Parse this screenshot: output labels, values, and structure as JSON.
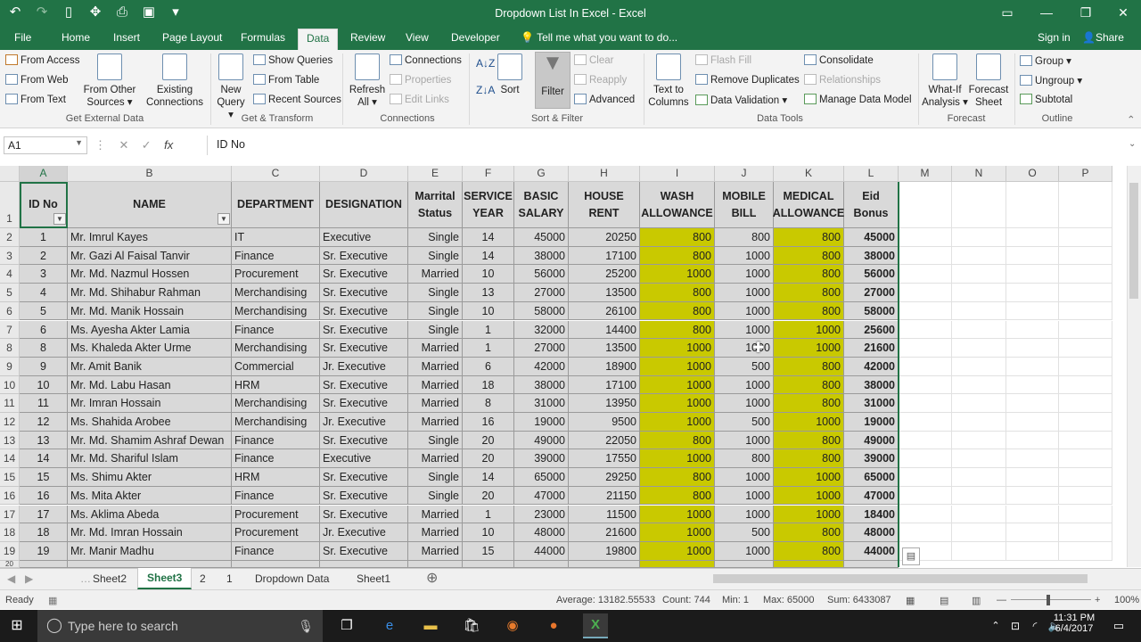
{
  "window": {
    "title": "Dropdown List In Excel - Excel"
  },
  "tabs": [
    "File",
    "Home",
    "Insert",
    "Page Layout",
    "Formulas",
    "Data",
    "Review",
    "View",
    "Developer"
  ],
  "tell_me": "Tell me what you want to do...",
  "sign_in": "Sign in",
  "share": "Share",
  "ribbon": {
    "get_external": {
      "from_access": "From Access",
      "from_web": "From Web",
      "from_text": "From Text",
      "from_other_1": "From Other",
      "from_other_2": "Sources",
      "existing_1": "Existing",
      "existing_2": "Connections",
      "label": "Get External Data"
    },
    "transform": {
      "new_query_1": "New",
      "new_query_2": "Query",
      "show_queries": "Show Queries",
      "from_table": "From Table",
      "recent_sources": "Recent Sources",
      "label": "Get & Transform"
    },
    "connections": {
      "refresh_1": "Refresh",
      "refresh_2": "All",
      "connections": "Connections",
      "properties": "Properties",
      "edit_links": "Edit Links",
      "label": "Connections"
    },
    "sortfilter": {
      "sort": "Sort",
      "filter": "Filter",
      "clear": "Clear",
      "reapply": "Reapply",
      "advanced": "Advanced",
      "label": "Sort & Filter"
    },
    "datatools": {
      "text_1": "Text to",
      "text_2": "Columns",
      "flash_fill": "Flash Fill",
      "remove_dup": "Remove Duplicates",
      "data_validation": "Data Validation",
      "consolidate": "Consolidate",
      "relationships": "Relationships",
      "manage_model": "Manage Data Model",
      "label": "Data Tools"
    },
    "forecast": {
      "whatif_1": "What-If",
      "whatif_2": "Analysis",
      "sheet_1": "Forecast",
      "sheet_2": "Sheet",
      "label": "Forecast"
    },
    "outline": {
      "group": "Group",
      "ungroup": "Ungroup",
      "subtotal": "Subtotal",
      "label": "Outline"
    }
  },
  "formula_bar": {
    "name_box": "A1",
    "content": "ID No"
  },
  "columns": [
    "A",
    "B",
    "C",
    "D",
    "E",
    "F",
    "G",
    "H",
    "I",
    "J",
    "K",
    "L",
    "M",
    "N",
    "O",
    "P"
  ],
  "headers": {
    "id": "ID No",
    "name": "NAME",
    "dept": "DEPARTMENT",
    "desig": "DESIGNATION",
    "status_1": "Marrital",
    "status_2": "Status",
    "service_1": "SERVICE",
    "service_2": "YEAR",
    "basic_1": "BASIC",
    "basic_2": "SALARY",
    "house": "HOUSE RENT",
    "wash_1": "WASH",
    "wash_2": "ALLOWANCE",
    "mobile_1": "MOBILE",
    "mobile_2": "BILL",
    "medical_1": "MEDICAL",
    "medical_2": "ALLOWANCE",
    "eid_1": "Eid",
    "eid_2": "Bonus"
  },
  "rows": [
    [
      "1",
      "Mr. Imrul Kayes",
      "IT",
      "Executive",
      "Single",
      "14",
      "45000",
      "20250",
      "800",
      "800",
      "800",
      "45000"
    ],
    [
      "2",
      "Mr. Gazi Al Faisal Tanvir",
      "Finance",
      "Sr. Executive",
      "Single",
      "14",
      "38000",
      "17100",
      "800",
      "1000",
      "800",
      "38000"
    ],
    [
      "3",
      "Mr. Md. Nazmul Hossen",
      "Procurement",
      "Sr. Executive",
      "Married",
      "10",
      "56000",
      "25200",
      "1000",
      "1000",
      "800",
      "56000"
    ],
    [
      "4",
      "Mr. Md. Shihabur Rahman",
      "Merchandising",
      "Sr. Executive",
      "Single",
      "13",
      "27000",
      "13500",
      "800",
      "1000",
      "800",
      "27000"
    ],
    [
      "5",
      "Mr. Md. Manik Hossain",
      "Merchandising",
      "Sr. Executive",
      "Single",
      "10",
      "58000",
      "26100",
      "800",
      "1000",
      "800",
      "58000"
    ],
    [
      "6",
      "Ms. Ayesha Akter Lamia",
      "Finance",
      "Sr. Executive",
      "Single",
      "1",
      "32000",
      "14400",
      "800",
      "1000",
      "1000",
      "25600"
    ],
    [
      "8",
      "Ms. Khaleda Akter Urme",
      "Merchandising",
      "Sr. Executive",
      "Married",
      "1",
      "27000",
      "13500",
      "1000",
      "1000",
      "1000",
      "21600"
    ],
    [
      "9",
      "Mr. Amit Banik",
      "Commercial",
      "Jr. Executive",
      "Married",
      "6",
      "42000",
      "18900",
      "1000",
      "500",
      "800",
      "42000"
    ],
    [
      "10",
      "Mr. Md. Labu Hasan",
      "HRM",
      "Sr. Executive",
      "Married",
      "18",
      "38000",
      "17100",
      "1000",
      "1000",
      "800",
      "38000"
    ],
    [
      "11",
      "Mr. Imran Hossain",
      "Merchandising",
      "Sr. Executive",
      "Married",
      "8",
      "31000",
      "13950",
      "1000",
      "1000",
      "800",
      "31000"
    ],
    [
      "12",
      "Ms. Shahida Arobee",
      "Merchandising",
      "Jr. Executive",
      "Married",
      "16",
      "19000",
      "9500",
      "1000",
      "500",
      "1000",
      "19000"
    ],
    [
      "13",
      "Mr. Md. Shamim Ashraf Dewan",
      "Finance",
      "Sr. Executive",
      "Single",
      "20",
      "49000",
      "22050",
      "800",
      "1000",
      "800",
      "49000"
    ],
    [
      "14",
      "Mr. Md. Shariful Islam",
      "Finance",
      "Executive",
      "Married",
      "20",
      "39000",
      "17550",
      "1000",
      "800",
      "800",
      "39000"
    ],
    [
      "15",
      "Ms. Shimu Akter",
      "HRM",
      "Sr. Executive",
      "Single",
      "14",
      "65000",
      "29250",
      "800",
      "1000",
      "1000",
      "65000"
    ],
    [
      "16",
      "Ms. Mita Akter",
      "Finance",
      "Sr. Executive",
      "Single",
      "20",
      "47000",
      "21150",
      "800",
      "1000",
      "1000",
      "47000"
    ],
    [
      "17",
      "Ms. Aklima Abeda",
      "Procurement",
      "Sr. Executive",
      "Married",
      "1",
      "23000",
      "11500",
      "1000",
      "1000",
      "1000",
      "18400"
    ],
    [
      "18",
      "Mr. Md. Imran Hossain",
      "Procurement",
      "Jr. Executive",
      "Married",
      "10",
      "48000",
      "21600",
      "1000",
      "500",
      "800",
      "48000"
    ],
    [
      "19",
      "Mr. Manir Madhu",
      "Finance",
      "Sr. Executive",
      "Married",
      "15",
      "44000",
      "19800",
      "1000",
      "1000",
      "800",
      "44000"
    ]
  ],
  "row_numbers": [
    "1",
    "2",
    "3",
    "4",
    "5",
    "6",
    "7",
    "8",
    "9",
    "10",
    "11",
    "12",
    "13",
    "14",
    "15",
    "16",
    "17",
    "18",
    "19"
  ],
  "sheets": [
    "Sheet2",
    "Sheet3",
    "2",
    "1",
    "Dropdown Data",
    "Sheet1"
  ],
  "status": {
    "ready": "Ready",
    "average": "Average: 13182.55533",
    "count": "Count: 744",
    "min": "Min: 1",
    "max": "Max: 65000",
    "sum": "Sum: 6433087",
    "zoom": "100%"
  },
  "taskbar": {
    "search": "Type here to search",
    "time": "11:31 PM",
    "date": "6/4/2017"
  },
  "colors": {
    "excel_green": "#217346",
    "highlight": "#c9c900",
    "header_grey": "#d9d9d9"
  }
}
